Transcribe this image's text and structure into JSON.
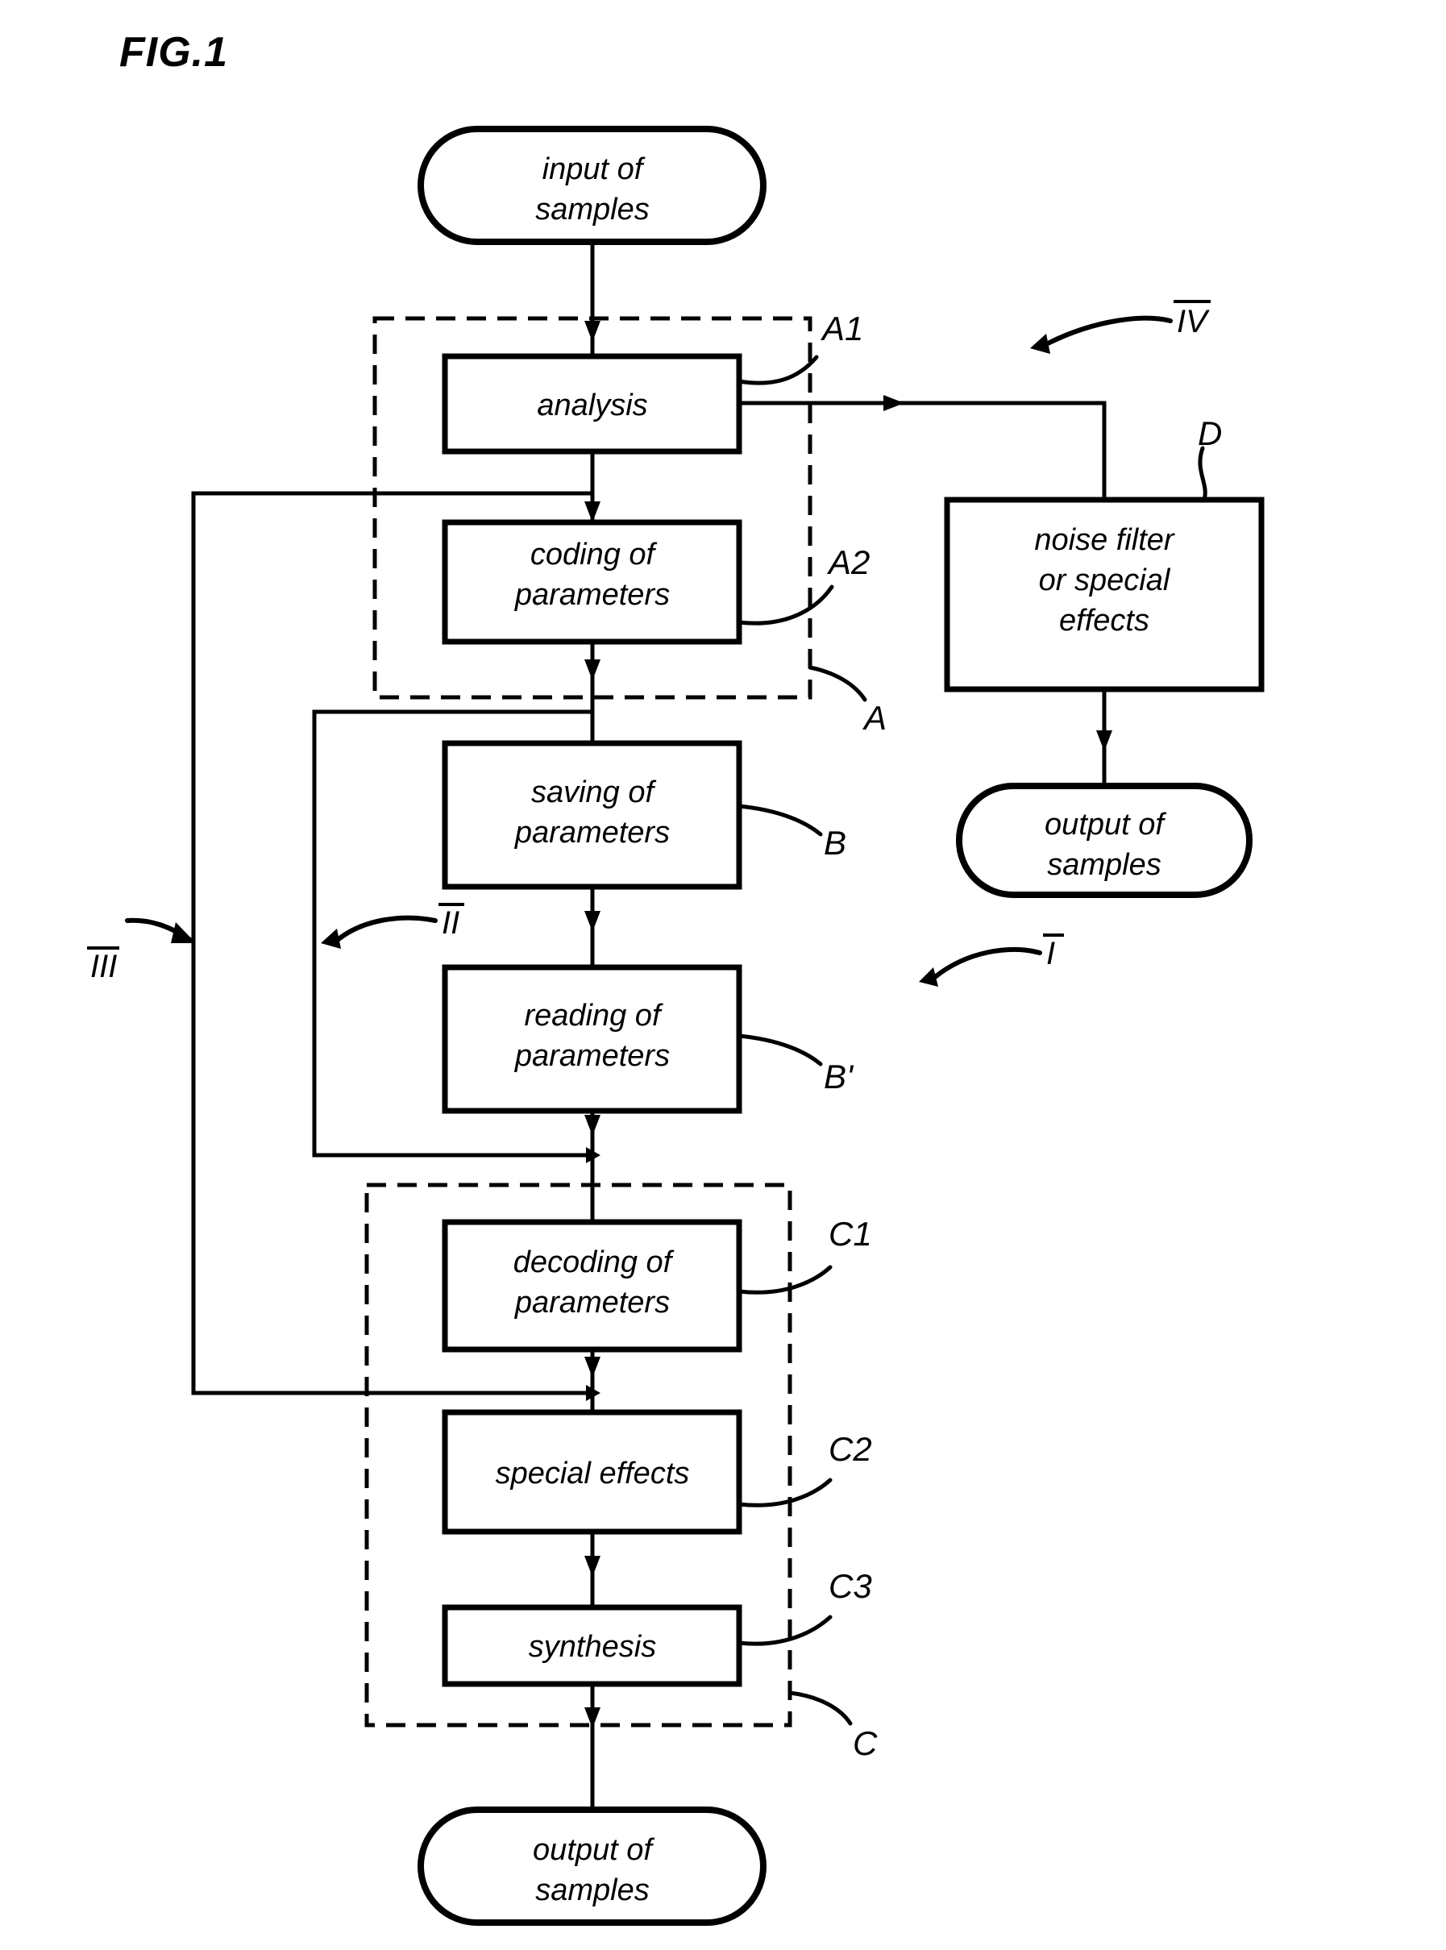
{
  "figure": {
    "title": "FIG.1",
    "type": "flowchart"
  },
  "nodes": {
    "input_samples": {
      "label_line1": "input of",
      "label_line2": "samples",
      "shape": "terminal"
    },
    "analysis": {
      "label_line1": "analysis",
      "label_line2": "",
      "shape": "process",
      "ref": "A1"
    },
    "coding": {
      "label_line1": "coding of",
      "label_line2": "parameters",
      "shape": "process",
      "ref": "A2"
    },
    "saving": {
      "label_line1": "saving of",
      "label_line2": "parameters",
      "shape": "process",
      "ref": "B"
    },
    "reading": {
      "label_line1": "reading of",
      "label_line2": "parameters",
      "shape": "process",
      "ref": "B'"
    },
    "decoding": {
      "label_line1": "decoding of",
      "label_line2": "parameters",
      "shape": "process",
      "ref": "C1"
    },
    "special_effects": {
      "label_line1": "special effects",
      "label_line2": "",
      "shape": "process",
      "ref": "C2"
    },
    "synthesis": {
      "label_line1": "synthesis",
      "label_line2": "",
      "shape": "process",
      "ref": "C3"
    },
    "output_samples_bottom": {
      "label_line1": "output of",
      "label_line2": "samples",
      "shape": "terminal"
    },
    "noise_filter": {
      "label_line1": "noise filter",
      "label_line2": "or special",
      "label_line3": "effects",
      "shape": "process",
      "ref": "D"
    },
    "output_samples_right": {
      "label_line1": "output of",
      "label_line2": "samples",
      "shape": "terminal"
    }
  },
  "groups": {
    "encoder": {
      "ref": "A",
      "style": "dashed"
    },
    "decoder": {
      "ref": "C",
      "style": "dashed"
    }
  },
  "references": {
    "a1": "A1",
    "a2": "A2",
    "a": "A",
    "b": "B",
    "b_prime": "B'",
    "c1": "C1",
    "c2": "C2",
    "c3": "C3",
    "c": "C",
    "d": "D"
  },
  "roman_markers": {
    "one": "I",
    "two": "II",
    "three": "III",
    "four": "IV"
  },
  "colors": {
    "stroke": "#000000",
    "fill": "#ffffff",
    "background": "#ffffff"
  }
}
